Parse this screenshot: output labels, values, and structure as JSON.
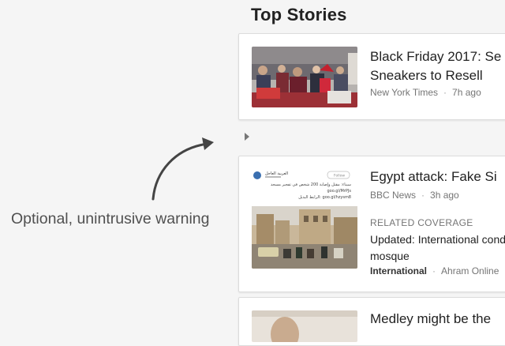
{
  "section": {
    "title": "Top Stories"
  },
  "annotation": {
    "text": "Optional, unintrusive warning"
  },
  "stories": [
    {
      "headline_line1": "Black Friday 2017: Se",
      "headline_line2": "Sneakers to Resell",
      "source": "New York Times",
      "time": "7h ago"
    },
    {
      "headline_line1": "Egypt attack: Fake Si",
      "source": "BBC News",
      "time": "3h ago",
      "related_label": "RELATED COVERAGE",
      "related_headline_line1": "Updated: International cond",
      "related_headline_line2": "mosque",
      "related_tag": "International",
      "related_source": "Ahram Online",
      "tweet": {
        "account": "العربية العاجل",
        "follow_label": "Follow",
        "text_line1": "سيناء: مقتل وإصابة 200 شخص في تفجير مسجد",
        "text_line2": "goo.gl/MrPJs",
        "text_line3": "الرابط البديل: goo.gl/hzysm8"
      }
    },
    {
      "headline_line1": "Medley might be the"
    }
  ],
  "colors": {
    "background": "#f5f5f5",
    "card": "#ffffff",
    "headline": "#222222",
    "meta": "#757575",
    "annotation": "#505050"
  }
}
